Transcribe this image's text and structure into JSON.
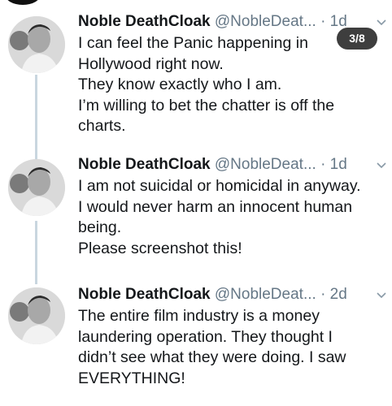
{
  "tweets": [
    {
      "name": "Noble DeathCloak",
      "handle": "@NobleDeat...",
      "separator": "·",
      "time": "1d",
      "lines": [
        "I can feel the Panic happening in",
        "Hollywood right now.",
        "They know exactly who I am.",
        "I’m willing to bet the chatter is off the",
        "charts."
      ]
    },
    {
      "name": "Noble DeathCloak",
      "handle": "@NobleDeat...",
      "separator": "·",
      "time": "1d",
      "lines": [
        "I am not suicidal or homicidal in anyway.",
        "I would never harm an innocent human",
        "being.",
        "Please screenshot this!"
      ]
    },
    {
      "name": "Noble DeathCloak",
      "handle": "@NobleDeat...",
      "separator": "·",
      "time": "2d",
      "lines": [
        "The entire film industry is a money",
        "laundering operation. They thought I",
        "didn’t see what they were doing. I saw",
        "EVERYTHING!"
      ]
    }
  ],
  "image_counter": "3/8",
  "icons": {
    "more": "chevron-down-icon",
    "avatar": "avatar"
  },
  "colors": {
    "text": "#14171a",
    "secondary": "#657786",
    "thread_line": "#c9d6df",
    "counter_bg": "#3e3e3e"
  }
}
